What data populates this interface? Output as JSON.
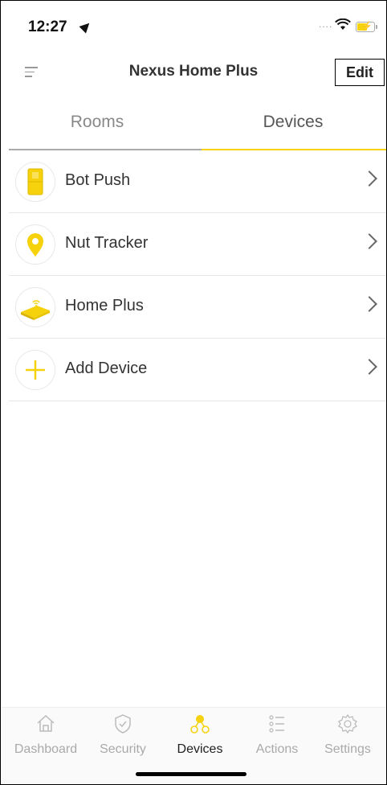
{
  "status_bar": {
    "time": "12:27"
  },
  "nav": {
    "title": "Nexus Home Plus",
    "edit_label": "Edit"
  },
  "tabs": [
    {
      "label": "Rooms",
      "active": false
    },
    {
      "label": "Devices",
      "active": true
    }
  ],
  "devices": [
    {
      "label": "Bot Push",
      "icon": "bot-push-icon"
    },
    {
      "label": "Nut Tracker",
      "icon": "location-pin-icon"
    },
    {
      "label": "Home Plus",
      "icon": "hub-icon"
    },
    {
      "label": "Add Device",
      "icon": "plus-icon"
    }
  ],
  "tab_bar": {
    "items": [
      {
        "label": "Dashboard",
        "icon": "home-icon",
        "active": false
      },
      {
        "label": "Security",
        "icon": "shield-icon",
        "active": false
      },
      {
        "label": "Devices",
        "icon": "devices-icon",
        "active": true
      },
      {
        "label": "Actions",
        "icon": "list-icon",
        "active": false
      },
      {
        "label": "Settings",
        "icon": "gear-icon",
        "active": false
      }
    ]
  },
  "colors": {
    "accent": "#f5d20b",
    "text": "#333333",
    "muted": "#aaaaaa"
  }
}
